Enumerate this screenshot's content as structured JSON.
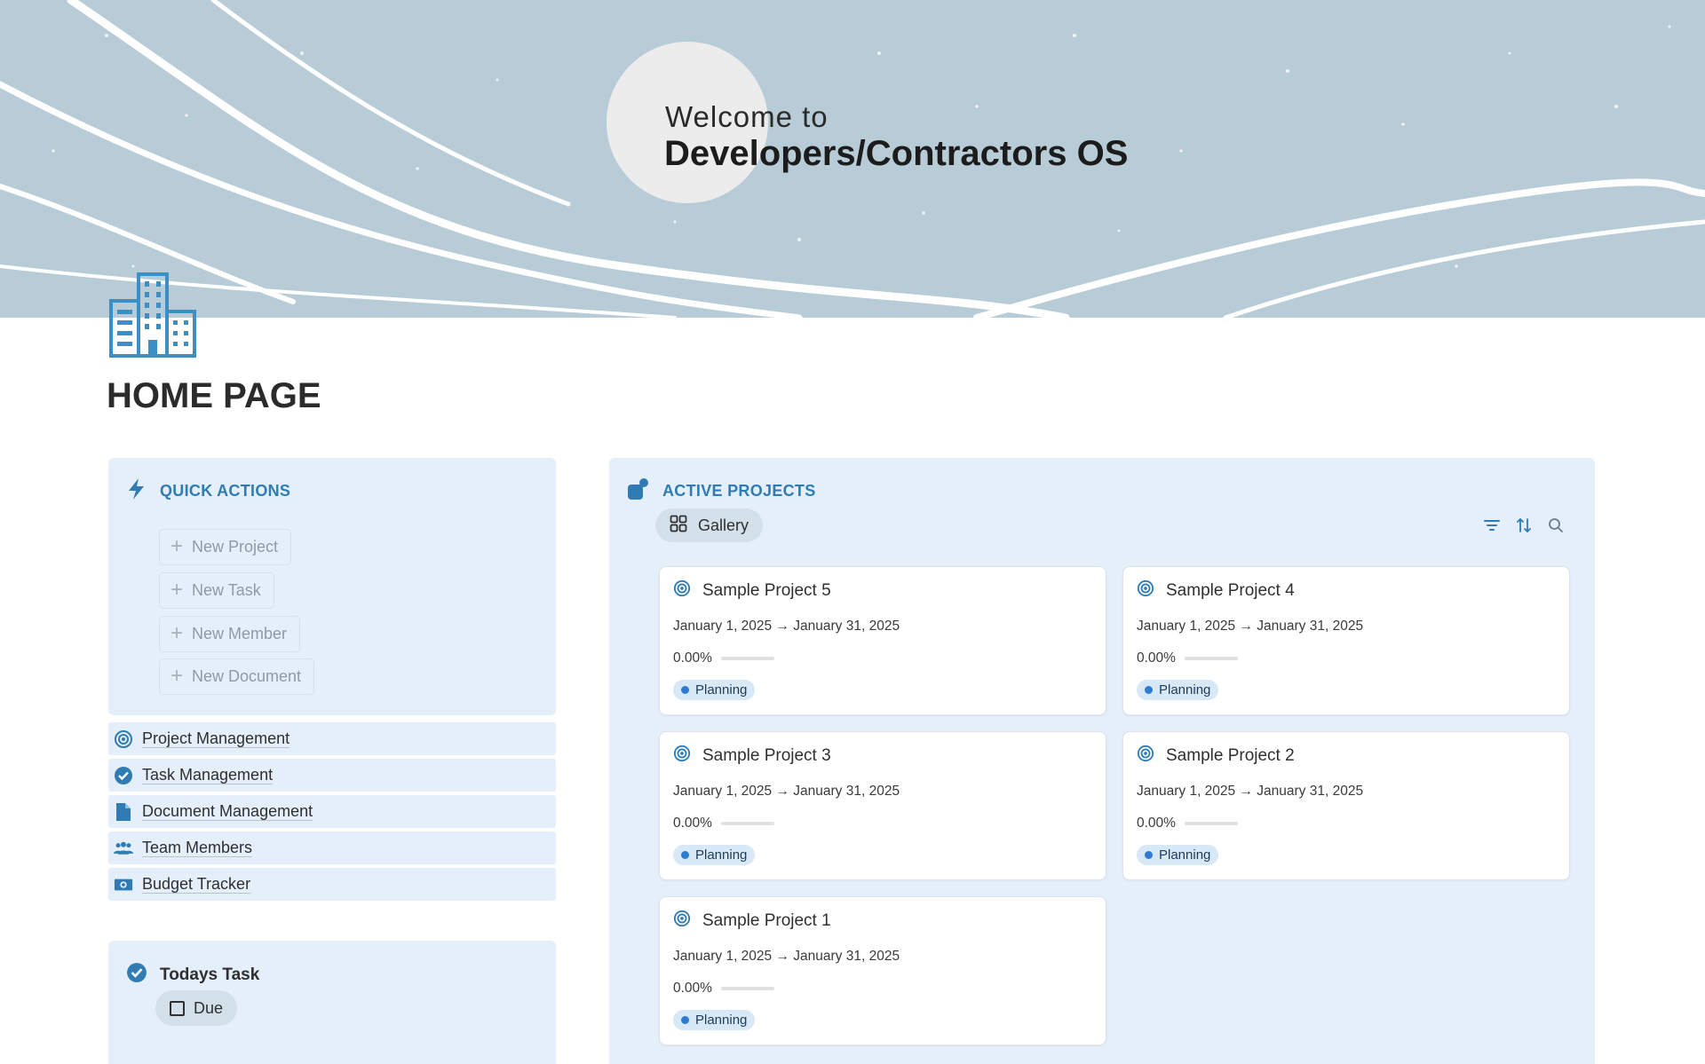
{
  "banner": {
    "welcome": "Welcome to",
    "title": "Developers/Contractors OS"
  },
  "page": {
    "title": "HOME PAGE",
    "icon": "building-icon"
  },
  "colors": {
    "accent": "#2f7bb4",
    "panel": "#e4eff9",
    "banner": "#b8ccd7",
    "status_dot": "#2c7bd4"
  },
  "quick_actions": {
    "title": "QUICK ACTIONS",
    "icon": "lightning-icon",
    "buttons": [
      "New Project",
      "New Task",
      "New Member",
      "New Document"
    ]
  },
  "nav": [
    {
      "label": "Project Management",
      "icon": "target-icon"
    },
    {
      "label": "Task Management",
      "icon": "check-circle-icon"
    },
    {
      "label": "Document Management",
      "icon": "document-icon"
    },
    {
      "label": "Team Members",
      "icon": "people-icon"
    },
    {
      "label": "Budget Tracker",
      "icon": "money-icon"
    }
  ],
  "todays_task": {
    "title": "Todays Task",
    "filter": "Due"
  },
  "active_projects": {
    "title": "ACTIVE PROJECTS",
    "view": "Gallery",
    "tools": [
      "filter-icon",
      "sort-icon",
      "search-icon"
    ],
    "cards": [
      {
        "name": "Sample Project 5",
        "dates": "January 1, 2025 → January 31, 2025",
        "progress": "0.00%",
        "progress_value": 0,
        "status": "Planning"
      },
      {
        "name": "Sample Project 4",
        "dates": "January 1, 2025 → January 31, 2025",
        "progress": "0.00%",
        "progress_value": 0,
        "status": "Planning"
      },
      {
        "name": "Sample Project 3",
        "dates": "January 1, 2025 → January 31, 2025",
        "progress": "0.00%",
        "progress_value": 0,
        "status": "Planning"
      },
      {
        "name": "Sample Project 2",
        "dates": "January 1, 2025 → January 31, 2025",
        "progress": "0.00%",
        "progress_value": 0,
        "status": "Planning"
      },
      {
        "name": "Sample Project 1",
        "dates": "January 1, 2025 → January 31, 2025",
        "progress": "0.00%",
        "progress_value": 0,
        "status": "Planning"
      }
    ]
  }
}
